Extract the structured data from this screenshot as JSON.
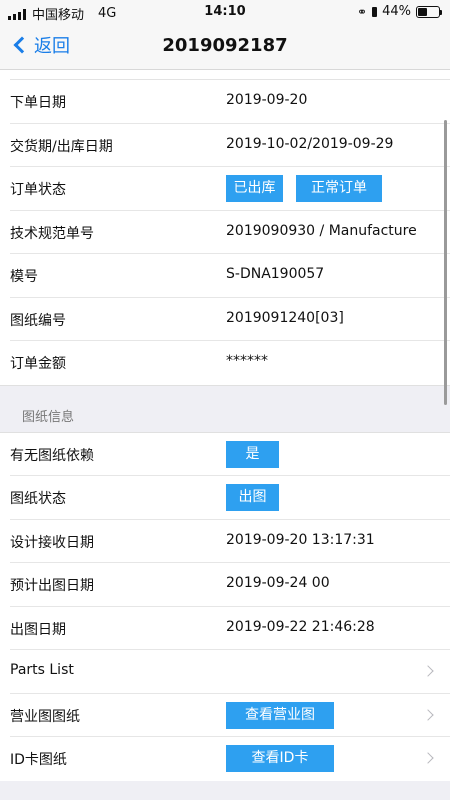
{
  "status_bar": {
    "carrier": "中国移动",
    "network": "4G",
    "time": "14:10",
    "battery": "44%",
    "battery_level": 0.44
  },
  "nav": {
    "back_label": "返回",
    "title": "2019092187"
  },
  "order": {
    "order_date_label": "下单日期",
    "order_date": "2019-09-20",
    "delivery_label": "交货期/出库日期",
    "delivery": "2019-10-02/2019-09-29",
    "status_label": "订单状态",
    "status_tag1": "已出库",
    "status_tag2": "正常订单",
    "spec_label": "技术规范单号",
    "spec": "2019090930 / Manufacture",
    "model_label": "模号",
    "model": "S-DNA190057",
    "drawing_no_label": "图纸编号",
    "drawing_no": "2019091240[03]",
    "amount_label": "订单金额",
    "amount": "******"
  },
  "drawing": {
    "section_title": "图纸信息",
    "dependency_label": "有无图纸依赖",
    "dependency": "是",
    "drawing_status_label": "图纸状态",
    "drawing_status": "出图",
    "design_received_label": "设计接收日期",
    "design_received": "2019-09-20 13:17:31",
    "planned_label": "预计出图日期",
    "planned": "2019-09-24 00",
    "issued_label": "出图日期",
    "issued": "2019-09-22 21:46:28",
    "parts_list_label": "Parts List",
    "business_label": "营业图图纸",
    "business_button": "查看营业图",
    "id_label": "ID卡图纸",
    "id_button": "查看ID卡"
  }
}
